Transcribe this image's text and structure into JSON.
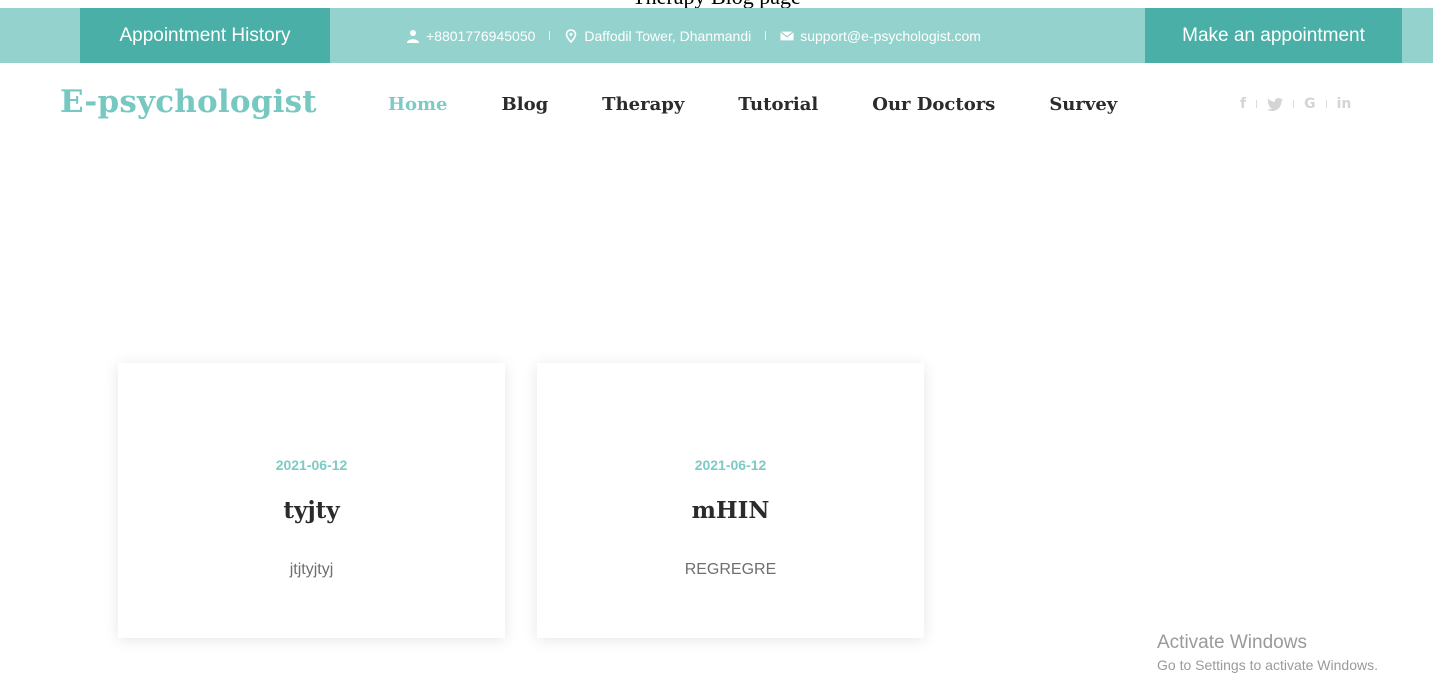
{
  "top_caption": "Therapy Blog page",
  "topbar": {
    "history_label": "Appointment History",
    "phone": "+8801776945050",
    "address": "Daffodil Tower, Dhanmandi",
    "email": "support@e-psychologist.com",
    "appointment_label": "Make an appointment"
  },
  "header": {
    "logo": "E-psychologist",
    "nav": [
      "Home",
      "Blog",
      "Therapy",
      "Tutorial",
      "Our Doctors",
      "Survey"
    ],
    "active_index": 0,
    "social": [
      "f",
      "twitter-icon",
      "G",
      "in"
    ]
  },
  "cards": [
    {
      "date": "2021-06-12",
      "title": "tyjty",
      "text": "jtjtyjtyj"
    },
    {
      "date": "2021-06-12",
      "title": "mHIN",
      "text": "REGREGRE"
    }
  ],
  "watermark": {
    "line1": "Activate Windows",
    "line2": "Go to Settings to activate Windows."
  },
  "colors": {
    "topbar": "#93d2cd",
    "accent_button": "#4ab0a7",
    "brand": "#78c8c2"
  }
}
